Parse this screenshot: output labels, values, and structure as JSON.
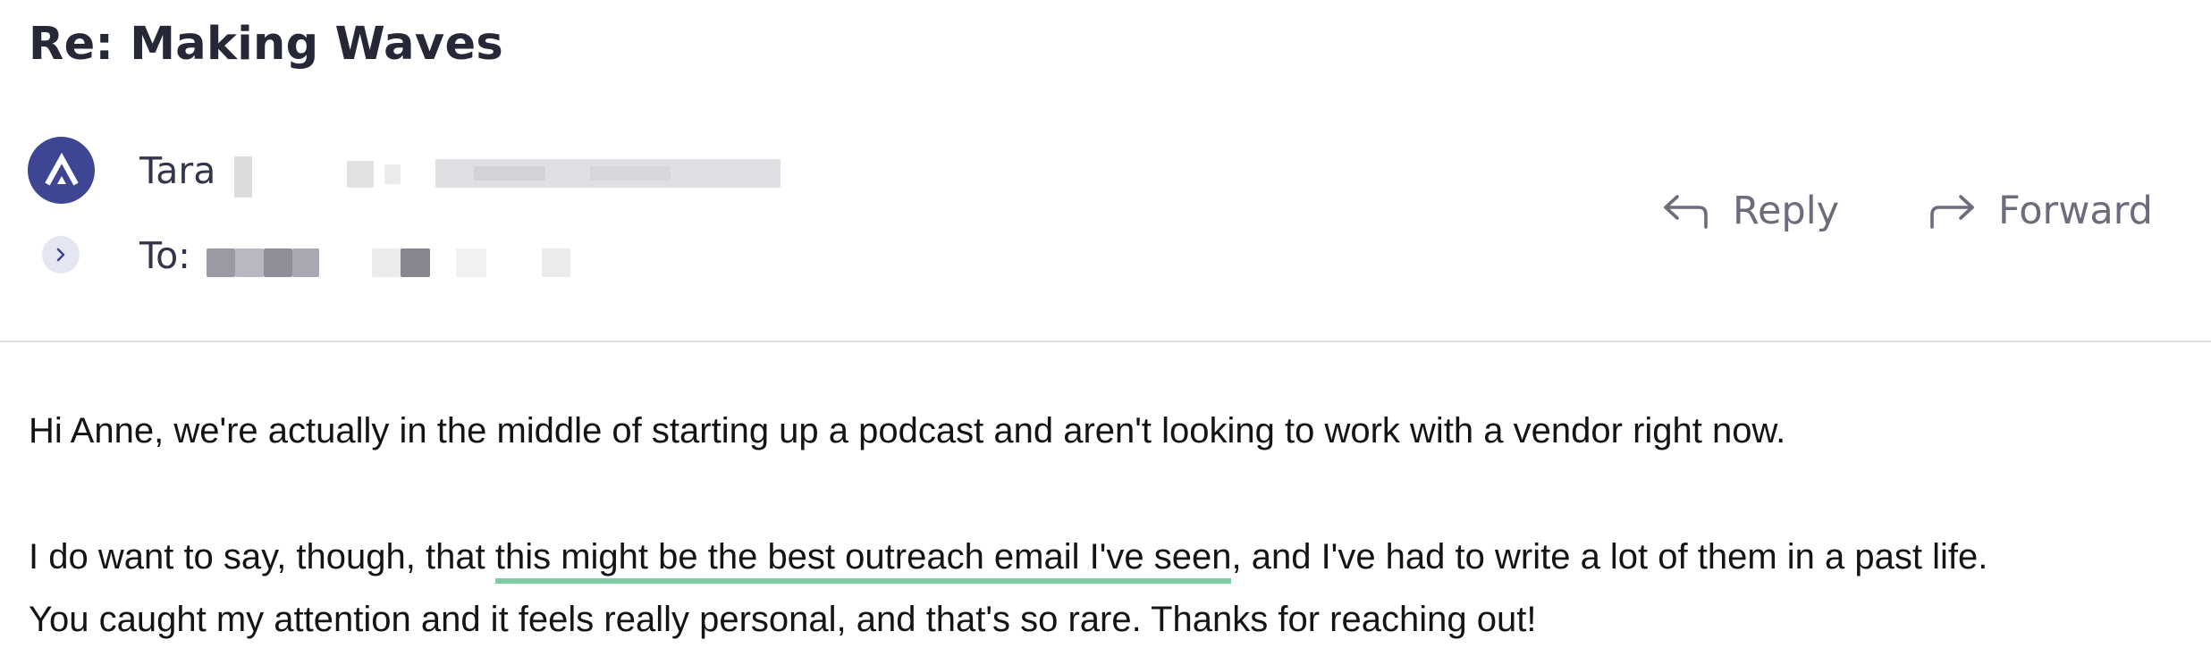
{
  "email": {
    "subject": "Re: Making Waves",
    "sender": {
      "avatar_icon": "logo-a-icon",
      "avatar_color": "#3e4593",
      "name": "Tara"
    },
    "recipients": {
      "label": "To:"
    },
    "actions": {
      "reply_label": "Reply",
      "reply_icon": "reply-arrow-icon",
      "forward_label": "Forward",
      "forward_icon": "forward-arrow-icon"
    },
    "body": {
      "paragraph1": "Hi Anne, we're actually in the middle of starting up a podcast and aren't looking to work with a vendor right now.",
      "paragraph2_line1_before": "I do want to say, though, that ",
      "paragraph2_highlight": "this might be the best outreach email I've seen",
      "paragraph2_line1_after": ", and I've had to write a lot of them in a past life.",
      "paragraph2_line2": "You caught my attention and it feels really personal, and that's so rare. Thanks for reaching out!"
    },
    "highlight_color": "#7fcba4"
  }
}
